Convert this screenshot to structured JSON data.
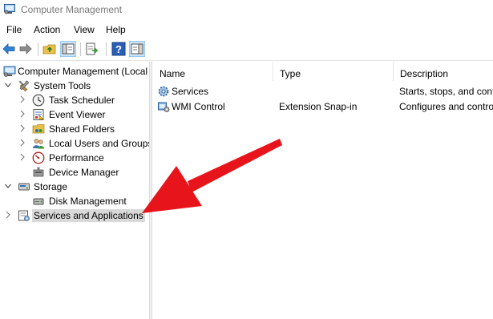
{
  "window": {
    "title": "Computer Management"
  },
  "menu": {
    "items": [
      "File",
      "Action",
      "View",
      "Help"
    ]
  },
  "toolbar": {
    "buttons": [
      "back-arrow-icon",
      "forward-arrow-icon",
      "up-folder-icon",
      "show-hide-tree-icon",
      "export-list-icon",
      "help-icon",
      "show-hide-action-pane-icon"
    ]
  },
  "tree": {
    "root": "Computer Management (Local",
    "system_tools": "System Tools",
    "task_scheduler": "Task Scheduler",
    "event_viewer": "Event Viewer",
    "shared_folders": "Shared Folders",
    "local_users": "Local Users and Groups",
    "performance": "Performance",
    "device_manager": "Device Manager",
    "storage": "Storage",
    "disk_management": "Disk Management",
    "services_apps": "Services and Applications"
  },
  "list": {
    "columns": [
      "Name",
      "Type",
      "Description"
    ],
    "rows": [
      {
        "name": "Services",
        "type": "",
        "description": "Starts, stops, and conf"
      },
      {
        "name": "WMI Control",
        "type": "Extension Snap-in",
        "description": "Configures and contro"
      }
    ]
  },
  "colors": {
    "arrow": "#e8141b",
    "selection": "#d9d9d9",
    "accent": "#1e73c8"
  }
}
